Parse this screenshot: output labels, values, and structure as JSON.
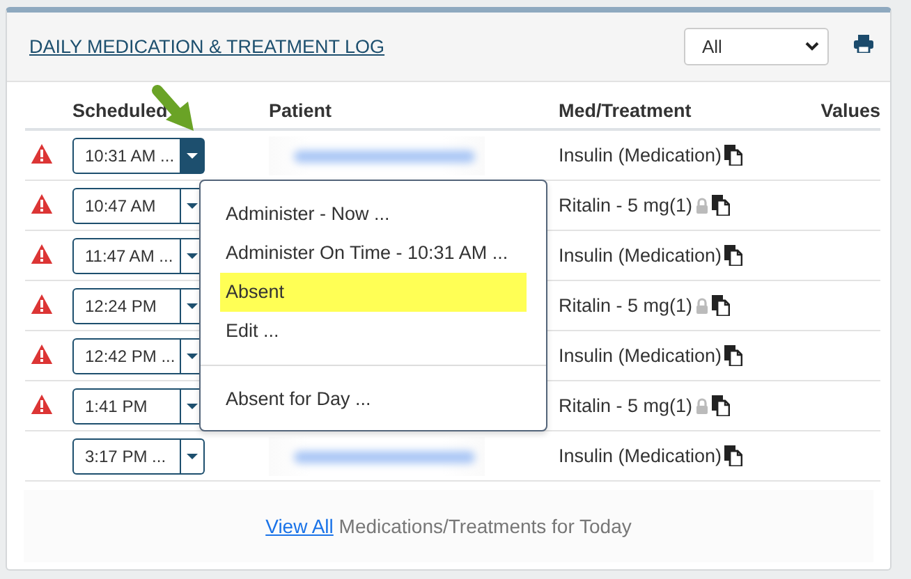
{
  "panel": {
    "title": "DAILY MEDICATION & TREATMENT LOG",
    "filter": {
      "value": "All"
    }
  },
  "table": {
    "columns": [
      "Scheduled",
      "Patient",
      "Med/Treatment",
      "Values"
    ],
    "rows": [
      {
        "alert": true,
        "time": "10:31 AM ...",
        "menu_open": true,
        "med": "Insulin (Medication)",
        "locked": false
      },
      {
        "alert": true,
        "time": "10:47 AM",
        "menu_open": false,
        "med": "Ritalin - 5 mg(1)",
        "locked": true
      },
      {
        "alert": true,
        "time": "11:47 AM ...",
        "menu_open": false,
        "med": "Insulin (Medication)",
        "locked": false
      },
      {
        "alert": true,
        "time": "12:24 PM",
        "menu_open": false,
        "med": "Ritalin - 5 mg(1)",
        "locked": true
      },
      {
        "alert": true,
        "time": "12:42 PM ...",
        "menu_open": false,
        "med": "Insulin (Medication)",
        "locked": false
      },
      {
        "alert": true,
        "time": "1:41 PM",
        "menu_open": false,
        "med": "Ritalin - 5 mg(1)",
        "locked": true
      },
      {
        "alert": false,
        "time": "3:17 PM ...",
        "menu_open": false,
        "med": "Insulin (Medication)",
        "locked": false
      }
    ]
  },
  "menu": {
    "items": [
      {
        "kind": "item",
        "label": "Administer - Now ...",
        "selected": false
      },
      {
        "kind": "item",
        "label": "Administer On Time - 10:31 AM ...",
        "selected": false
      },
      {
        "kind": "item",
        "label": "Absent",
        "selected": true
      },
      {
        "kind": "item",
        "label": "Edit ...",
        "selected": false
      },
      {
        "kind": "separator"
      },
      {
        "kind": "item",
        "label": "Absent for Day ...",
        "selected": false
      }
    ]
  },
  "footer": {
    "link": "View All",
    "text": "Medications/Treatments for Today"
  }
}
